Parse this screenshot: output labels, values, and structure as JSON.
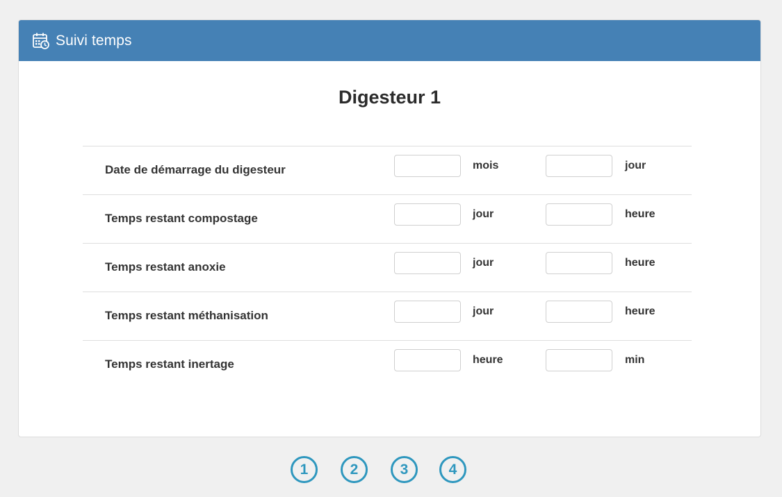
{
  "header": {
    "title": "Suivi temps",
    "icon": "calendar-clock-icon",
    "background": "#4581b5"
  },
  "main": {
    "title": "Digesteur 1"
  },
  "rows": [
    {
      "label": "Date de démarrage du digesteur",
      "value_1": "",
      "unit_1": "mois",
      "value_2": "",
      "unit_2": "jour"
    },
    {
      "label": "Temps restant compostage",
      "value_1": "",
      "unit_1": "jour",
      "value_2": "",
      "unit_2": "heure"
    },
    {
      "label": "Temps restant anoxie",
      "value_1": "",
      "unit_1": "jour",
      "value_2": "",
      "unit_2": "heure"
    },
    {
      "label": "Temps restant méthanisation",
      "value_1": "",
      "unit_1": "jour",
      "value_2": "",
      "unit_2": "heure"
    },
    {
      "label": "Temps restant inertage",
      "value_1": "",
      "unit_1": "heure",
      "value_2": "",
      "unit_2": "min"
    }
  ],
  "pagination": {
    "pages": [
      "1",
      "2",
      "3",
      "4"
    ],
    "color": "#2e97be"
  }
}
